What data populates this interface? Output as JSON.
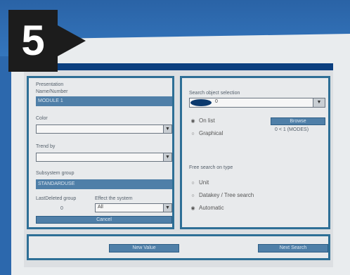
{
  "step_badge": "5",
  "window": {
    "title": ""
  },
  "left_panel": {
    "section_label": "Presentation",
    "name_label": "Name/Number",
    "name_value": "MODULE 1",
    "color_label": "Color",
    "color_value": "",
    "trend_label": "Trend by",
    "trend_value": "",
    "subsystem_label": "Subsystem group",
    "subsystem_value": "STANDARDUSE",
    "lastdeleted_label": "LastDeleted group",
    "lastdeleted_value": "0",
    "effect_label": "Effect the system",
    "effect_value": "All",
    "cancel_label": "Cancel"
  },
  "right_panel": {
    "search_label": "Search object selection",
    "search_value": "0",
    "radio_top_1": "On list",
    "radio_top_2": "Graphical",
    "browse_label": "Browse",
    "count_text": "0 < 1 (MODES)",
    "type_label": "Free search on type",
    "radio_1": "Unit",
    "radio_2": "Datakey / Tree search",
    "radio_3": "Automatic"
  },
  "bottom": {
    "left_button": "New Value",
    "right_button": "Next Search"
  }
}
